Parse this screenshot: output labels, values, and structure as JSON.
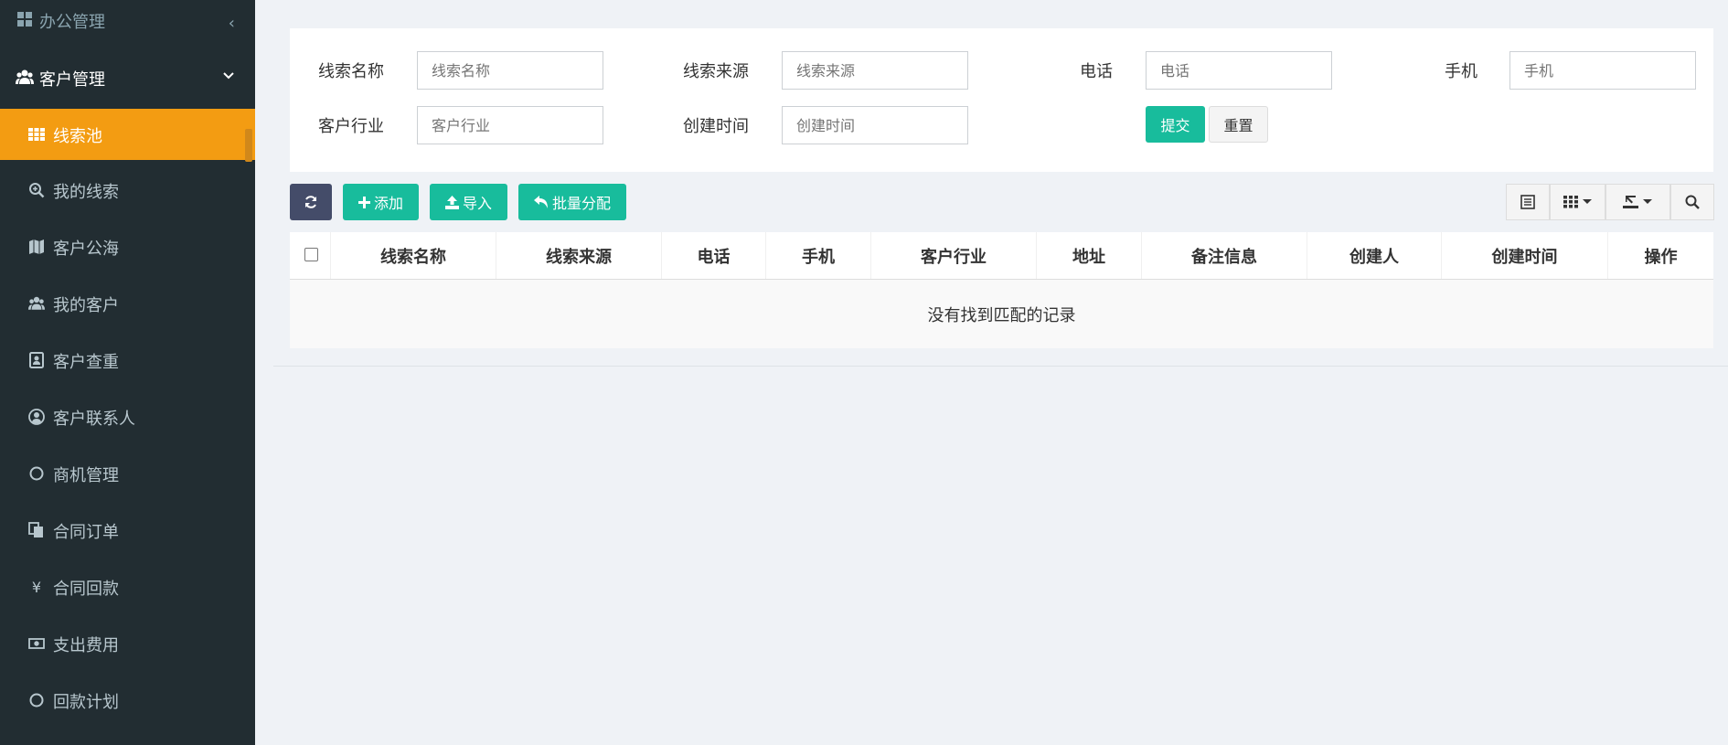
{
  "sidebar": {
    "top_label": "办公管理",
    "group_label": "客户管理",
    "items": [
      {
        "label": "线索池",
        "icon": "grid-icon",
        "active": true
      },
      {
        "label": "我的线索",
        "icon": "search-plus-icon"
      },
      {
        "label": "客户公海",
        "icon": "map-icon"
      },
      {
        "label": "我的客户",
        "icon": "users-icon"
      },
      {
        "label": "客户查重",
        "icon": "id-card-icon"
      },
      {
        "label": "客户联系人",
        "icon": "user-circle-icon"
      },
      {
        "label": "商机管理",
        "icon": "circle-icon"
      },
      {
        "label": "合同订单",
        "icon": "copy-icon"
      },
      {
        "label": "合同回款",
        "icon": "yen-icon"
      },
      {
        "label": "支出费用",
        "icon": "money-icon"
      },
      {
        "label": "回款计划",
        "icon": "circle-icon"
      }
    ],
    "bg": "#222d32",
    "active_color": "#f39c12"
  },
  "search": {
    "fields": [
      {
        "label": "线索名称",
        "placeholder": "线索名称"
      },
      {
        "label": "线索来源",
        "placeholder": "线索来源"
      },
      {
        "label": "电话",
        "placeholder": "电话"
      },
      {
        "label": "手机",
        "placeholder": "手机"
      },
      {
        "label": "客户行业",
        "placeholder": "客户行业"
      },
      {
        "label": "创建时间",
        "placeholder": "创建时间"
      }
    ],
    "submit_label": "提交",
    "reset_label": "重置"
  },
  "toolbar": {
    "add_label": "添加",
    "import_label": "导入",
    "assign_label": "批量分配",
    "accent": "#18bc9c",
    "refresh_color": "#444c69"
  },
  "table": {
    "columns": [
      "线索名称",
      "线索来源",
      "电话",
      "手机",
      "客户行业",
      "地址",
      "备注信息",
      "创建人",
      "创建时间",
      "操作"
    ],
    "empty_text": "没有找到匹配的记录"
  }
}
